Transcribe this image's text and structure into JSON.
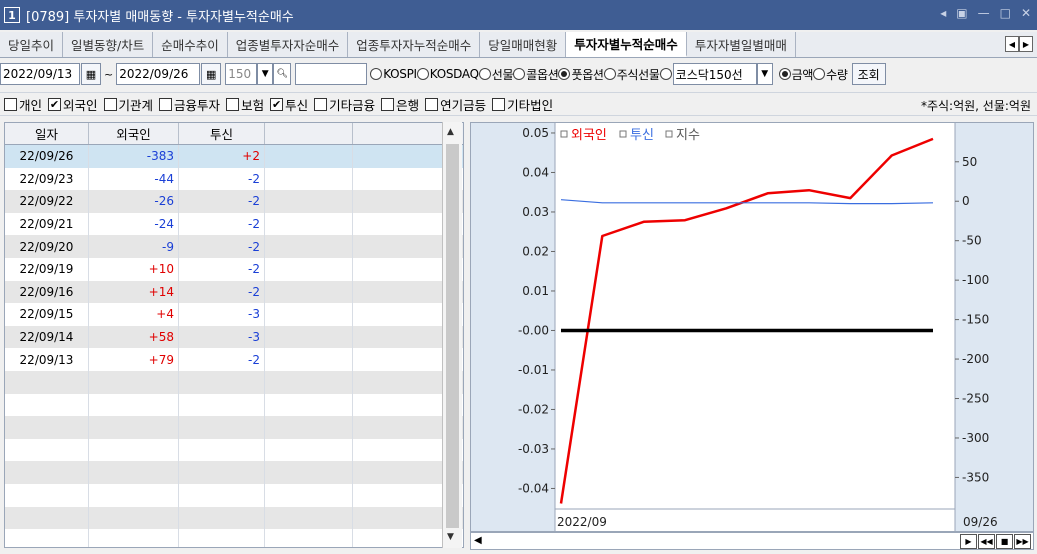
{
  "window": {
    "number": "1",
    "title": "[0789] 투자자별 매매동향 - 투자자별누적순매수",
    "controls": [
      "◂",
      "▣",
      "—",
      "□",
      "✕"
    ]
  },
  "tabs": [
    {
      "label": "당일추이",
      "active": false
    },
    {
      "label": "일별동향/차트",
      "active": false
    },
    {
      "label": "순매수추이",
      "active": false
    },
    {
      "label": "업종별투자자순매수",
      "active": false
    },
    {
      "label": "업종투자자누적순매수",
      "active": false
    },
    {
      "label": "당일매매현황",
      "active": false
    },
    {
      "label": "투자자별누적순매수",
      "active": true
    },
    {
      "label": "투자자별일별매매",
      "active": false
    }
  ],
  "toolbar": {
    "start_date": "2022/09/13",
    "tilde": "~",
    "end_date": "2022/09/26",
    "count": "150",
    "code_value": "",
    "markets": [
      {
        "label": "KOSPI",
        "selected": false
      },
      {
        "label": "KOSDAQ",
        "selected": false
      },
      {
        "label": "선물",
        "selected": false
      },
      {
        "label": "콜옵션",
        "selected": false
      },
      {
        "label": "풋옵션",
        "selected": true
      },
      {
        "label": "주식선물",
        "selected": false
      },
      {
        "label": "",
        "selected": false
      }
    ],
    "combo_value": "코스닥150선",
    "units": [
      {
        "label": "금액",
        "selected": true
      },
      {
        "label": "수량",
        "selected": false
      }
    ],
    "query_label": "조회"
  },
  "investors": [
    {
      "label": "개인",
      "checked": false
    },
    {
      "label": "외국인",
      "checked": true
    },
    {
      "label": "기관계",
      "checked": false
    },
    {
      "label": "금융투자",
      "checked": false
    },
    {
      "label": "보험",
      "checked": false
    },
    {
      "label": "투신",
      "checked": true
    },
    {
      "label": "기타금융",
      "checked": false
    },
    {
      "label": "은행",
      "checked": false
    },
    {
      "label": "연기금등",
      "checked": false
    },
    {
      "label": "기타법인",
      "checked": false
    }
  ],
  "unit_note": "*주식:억원, 선물:억원",
  "table": {
    "headers": [
      "일자",
      "외국인",
      "투신",
      "",
      ""
    ],
    "rows": [
      {
        "date": "22/09/26",
        "foreign": "-383",
        "trust": "+2"
      },
      {
        "date": "22/09/23",
        "foreign": "-44",
        "trust": "-2"
      },
      {
        "date": "22/09/22",
        "foreign": "-26",
        "trust": "-2"
      },
      {
        "date": "22/09/21",
        "foreign": "-24",
        "trust": "-2"
      },
      {
        "date": "22/09/20",
        "foreign": "-9",
        "trust": "-2"
      },
      {
        "date": "22/09/19",
        "foreign": "+10",
        "trust": "-2"
      },
      {
        "date": "22/09/16",
        "foreign": "+14",
        "trust": "-2"
      },
      {
        "date": "22/09/15",
        "foreign": "+4",
        "trust": "-3"
      },
      {
        "date": "22/09/14",
        "foreign": "+58",
        "trust": "-3"
      },
      {
        "date": "22/09/13",
        "foreign": "+79",
        "trust": "-2"
      }
    ],
    "empty_rows": 8
  },
  "colors": {
    "positive": "#e00000",
    "negative": "#1a3fd6",
    "foreign_line": "#ee0000",
    "trust_line": "#3a6ee0",
    "index_line": "#000000"
  },
  "chart_data": {
    "type": "line",
    "categories": [
      "22/09/13",
      "22/09/14",
      "22/09/15",
      "22/09/16",
      "22/09/19",
      "22/09/20",
      "22/09/21",
      "22/09/22",
      "22/09/23",
      "22/09/26"
    ],
    "x_start_label": "2022/09",
    "x_end_label": "09/26",
    "left_axis": {
      "ticks": [
        "0.05",
        "0.04",
        "0.03",
        "0.02",
        "0.01",
        "-0.00",
        "-0.01",
        "-0.02",
        "-0.03",
        "-0.04"
      ],
      "range": [
        -0.0452,
        0.0505
      ]
    },
    "right_axis": {
      "ticks": [
        "50",
        "0",
        "-50",
        "-100",
        "-150",
        "-200",
        "-250",
        "-300",
        "-350"
      ],
      "range": [
        -390,
        89
      ]
    },
    "legend": [
      {
        "name": "외국인",
        "color": "#ee0000"
      },
      {
        "name": "투신",
        "color": "#3a6ee0"
      },
      {
        "name": "지수",
        "color": "#555555"
      }
    ],
    "series": [
      {
        "name": "외국인",
        "axis": "right",
        "values": [
          79,
          58,
          4,
          14,
          10,
          -9,
          -24,
          -26,
          -44,
          -383
        ]
      },
      {
        "name": "투신",
        "axis": "right",
        "values": [
          -2,
          -3,
          -3,
          -2,
          -2,
          -2,
          -2,
          -2,
          -2,
          2
        ]
      },
      {
        "name": "지수",
        "axis": "left",
        "values": [
          0,
          0,
          0,
          0,
          0,
          0,
          0,
          0,
          0,
          0
        ]
      }
    ]
  }
}
